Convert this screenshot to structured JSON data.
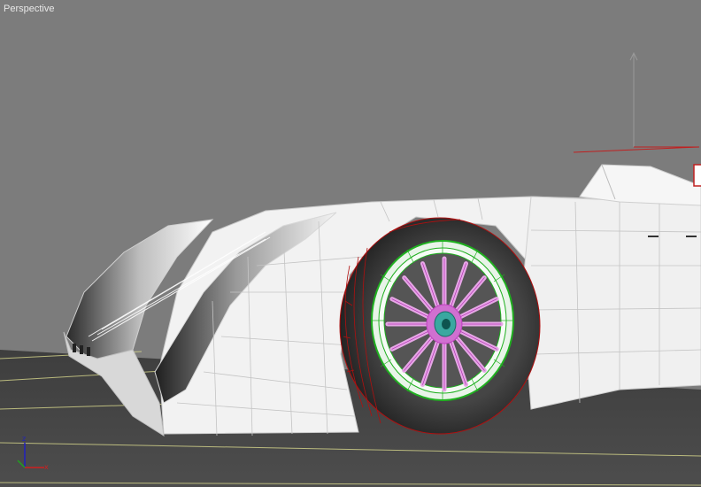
{
  "viewport": {
    "label": "Perspective",
    "background": "#7c7c7c"
  },
  "axis_gizmo": {
    "x_label": "x",
    "z_label": "z",
    "x_color": "#d02020",
    "y_color": "#20a020",
    "z_color": "#2020c0"
  },
  "scene": {
    "ground_color": "#4a4a4a",
    "grid_color": "#d8d88c",
    "body_color": "#f2f2f2",
    "tire_color": "#2a2a2a",
    "tire_wire_color": "#b01010",
    "rim_color": "#e8f4e8",
    "rim_wire_color": "#20b020",
    "spoke_color": "#e0a0e0",
    "spoke_wire_color": "#c040c0",
    "hub_color": "#3aa8a0"
  }
}
